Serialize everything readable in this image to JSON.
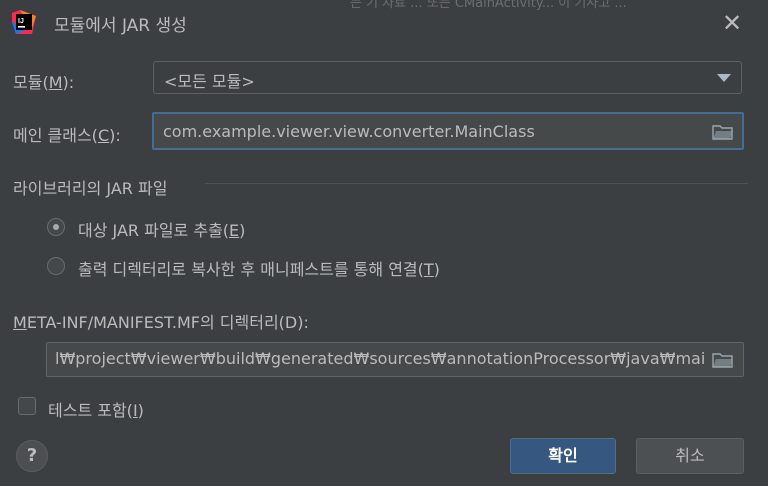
{
  "window": {
    "title": "모듈에서 JAR 생성",
    "background_ghost_text": "는 기 자료 ...  또는 CMainActivity... 이 기사고 ..."
  },
  "module": {
    "label_prefix": "모듈(",
    "label_mnemonic": "M",
    "label_suffix": "):",
    "value": "<모든 모듈>"
  },
  "main_class": {
    "label_prefix": "메인 클래스(",
    "label_mnemonic": "C",
    "label_suffix": "):",
    "value": "com.example.viewer.view.converter.MainClass"
  },
  "library_section": {
    "title": "라이브러리의 JAR 파일",
    "options": [
      {
        "label_prefix": "대상 JAR 파일로 추출(",
        "mnemonic": "E",
        "label_suffix": ")",
        "selected": true
      },
      {
        "label_prefix": "출력 디렉터리로 복사한 후 매니페스트를 통해 연결(",
        "mnemonic": "T",
        "label_suffix": ")",
        "selected": false
      }
    ]
  },
  "manifest": {
    "label_mnemonic": "M",
    "label_rest": "ETA-INF/MANIFEST.MF의 디렉터리(D):",
    "value": "l₩project₩viewer₩build₩generated₩sources₩annotationProcessor₩java₩main"
  },
  "include_tests": {
    "label_prefix": "테스트 포함(",
    "mnemonic": "I",
    "label_suffix": ")",
    "checked": false
  },
  "buttons": {
    "help": "?",
    "ok": "확인",
    "cancel": "취소"
  },
  "icons": {
    "app": "intellij-idea-icon",
    "close": "close-icon",
    "dropdown": "chevron-down-icon",
    "folder": "folder-icon",
    "help": "help-icon"
  },
  "colors": {
    "dialog_bg": "#3c3f41",
    "field_bg": "#45494a",
    "focus_border": "#466d94",
    "ok_button": "#365880"
  }
}
